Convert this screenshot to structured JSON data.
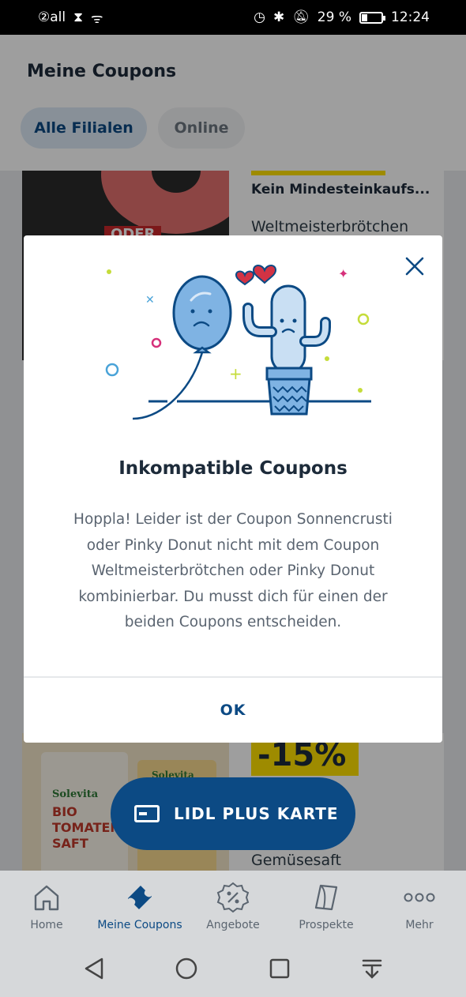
{
  "status_bar": {
    "signal": "②all",
    "battery": "29 %",
    "time": "12:24"
  },
  "header": {
    "title": "Meine Coupons",
    "tabs": [
      {
        "label": "Alle Filialen",
        "active": true
      },
      {
        "label": "Online",
        "active": false
      }
    ]
  },
  "coupons": [
    {
      "condition": "Kein Mindesteinkaufs...",
      "name": "Weltmeisterbrötchen",
      "image_overlay": "ODER"
    },
    {
      "price_badge": "-15%",
      "name": "Gemüsesaft",
      "carton_text": "BIO TOMATEN SAFT",
      "brand": "Solevita"
    }
  ],
  "floating_button": {
    "label": "LIDL PLUS KARTE"
  },
  "modal": {
    "title": "Inkompatible Coupons",
    "body": "Hoppla! Leider ist der Coupon Sonnencrusti oder Pinky Donut nicht mit dem Coupon Weltmeisterbrötchen oder Pinky Donut kombinierbar. Du musst dich für einen der beiden Coupons entscheiden.",
    "ok_label": "OK"
  },
  "bottom_nav": [
    {
      "label": "Home",
      "icon": "home-icon",
      "active": false
    },
    {
      "label": "Meine Coupons",
      "icon": "coupon-icon",
      "active": true
    },
    {
      "label": "Angebote",
      "icon": "percent-badge-icon",
      "active": false
    },
    {
      "label": "Prospekte",
      "icon": "brochure-icon",
      "active": false
    },
    {
      "label": "Mehr",
      "icon": "more-icon",
      "active": false
    }
  ],
  "colors": {
    "primary": "#0c4a84",
    "accent_yellow": "#ffe000",
    "balloon": "#7fb3e3",
    "cactus": "#c9dff3",
    "confetti_green": "#c5dc3a",
    "confetti_pink": "#d6307a",
    "heart": "#d23344"
  }
}
